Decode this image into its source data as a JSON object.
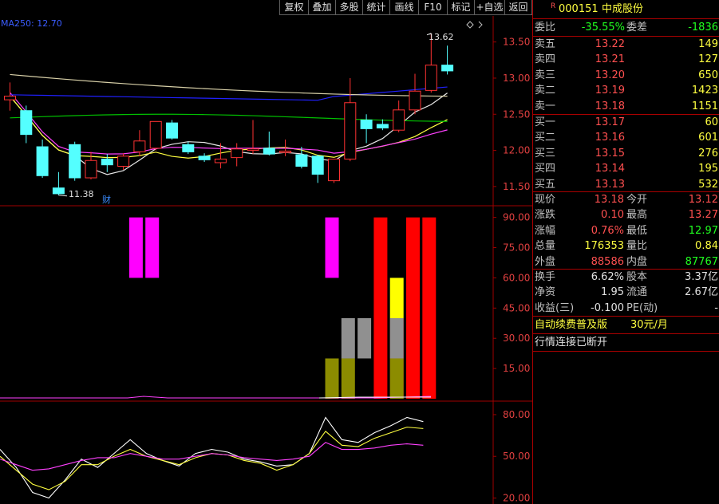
{
  "toolbar": {
    "buttons": [
      "复权",
      "叠加",
      "多股",
      "统计",
      "画线",
      "F10",
      "标记",
      "+自选",
      "返回"
    ]
  },
  "colors": {
    "up": "#ff3232",
    "down": "#54ffff",
    "ma_white": "#e8e8e8",
    "ma_yellow": "#ffff40",
    "ma_magenta": "#ff40ff",
    "ma_green": "#00c000",
    "ma250": "#2020ff",
    "grid": "#a00000"
  },
  "main_chart": {
    "ma_label": "MA250: 12.70",
    "y_ticks": [
      "13.50",
      "13.00",
      "12.50",
      "12.00",
      "11.50"
    ],
    "max_label": "13.62",
    "min_label": "11.38",
    "finance_mark": "财"
  },
  "vol_chart": {
    "y_ticks": [
      "90.00",
      "75.00",
      "60.00",
      "45.00",
      "30.00",
      "15.00"
    ]
  },
  "osc_chart": {
    "y_ticks": [
      "80.00",
      "50.00",
      "20.00"
    ]
  },
  "chart_data": [
    {
      "type": "candlestick",
      "y_range": [
        11.3,
        13.75
      ],
      "candles": [
        {
          "o": 12.7,
          "h": 12.94,
          "l": 12.55,
          "c": 12.75
        },
        {
          "o": 12.55,
          "h": 12.62,
          "l": 12.1,
          "c": 12.22
        },
        {
          "o": 12.05,
          "h": 12.15,
          "l": 11.62,
          "c": 11.65
        },
        {
          "o": 11.48,
          "h": 11.7,
          "l": 11.38,
          "c": 11.4
        },
        {
          "o": 12.08,
          "h": 12.12,
          "l": 11.58,
          "c": 11.62
        },
        {
          "o": 11.62,
          "h": 11.98,
          "l": 11.6,
          "c": 11.86
        },
        {
          "o": 11.88,
          "h": 11.95,
          "l": 11.7,
          "c": 11.8
        },
        {
          "o": 11.78,
          "h": 11.96,
          "l": 11.73,
          "c": 11.92
        },
        {
          "o": 11.98,
          "h": 12.28,
          "l": 11.92,
          "c": 12.13
        },
        {
          "o": 12.03,
          "h": 12.4,
          "l": 12.0,
          "c": 12.4
        },
        {
          "o": 12.38,
          "h": 12.42,
          "l": 12.15,
          "c": 12.17
        },
        {
          "o": 12.08,
          "h": 12.12,
          "l": 11.95,
          "c": 11.98
        },
        {
          "o": 11.92,
          "h": 11.96,
          "l": 11.84,
          "c": 11.87
        },
        {
          "o": 11.83,
          "h": 12.1,
          "l": 11.75,
          "c": 11.88
        },
        {
          "o": 11.9,
          "h": 12.1,
          "l": 11.78,
          "c": 12.02
        },
        {
          "o": 12.0,
          "h": 12.42,
          "l": 11.95,
          "c": 12.02
        },
        {
          "o": 12.03,
          "h": 12.26,
          "l": 11.93,
          "c": 11.95
        },
        {
          "o": 11.97,
          "h": 12.15,
          "l": 11.92,
          "c": 11.99
        },
        {
          "o": 11.94,
          "h": 12.05,
          "l": 11.75,
          "c": 11.78
        },
        {
          "o": 11.92,
          "h": 11.94,
          "l": 11.55,
          "c": 11.67
        },
        {
          "o": 11.58,
          "h": 11.88,
          "l": 11.55,
          "c": 11.88
        },
        {
          "o": 11.88,
          "h": 13.0,
          "l": 11.85,
          "c": 12.66
        },
        {
          "o": 12.42,
          "h": 12.5,
          "l": 12.1,
          "c": 12.3
        },
        {
          "o": 12.36,
          "h": 12.43,
          "l": 12.28,
          "c": 12.31
        },
        {
          "o": 12.28,
          "h": 12.69,
          "l": 12.25,
          "c": 12.56
        },
        {
          "o": 12.56,
          "h": 13.06,
          "l": 12.5,
          "c": 12.82
        },
        {
          "o": 12.83,
          "h": 13.62,
          "l": 12.8,
          "c": 13.18
        },
        {
          "o": 13.18,
          "h": 13.45,
          "l": 13.05,
          "c": 13.1
        }
      ]
    },
    {
      "type": "bar",
      "y_range": [
        0,
        95
      ],
      "bars": [
        {
          "i": 8,
          "color": "#ff00ff",
          "bottom": 60,
          "top": 90
        },
        {
          "i": 9,
          "color": "#ff00ff",
          "bottom": 60,
          "top": 90
        },
        {
          "i": 20,
          "color": "#ff00ff",
          "bottom": 60,
          "top": 90
        },
        {
          "i": 20,
          "color": "#8c8c00",
          "bottom": 0,
          "top": 20
        },
        {
          "i": 21,
          "color": "#8c8c00",
          "bottom": 0,
          "top": 20
        },
        {
          "i": 21,
          "color": "#909090",
          "bottom": 20,
          "top": 40
        },
        {
          "i": 22,
          "color": "#909090",
          "bottom": 20,
          "top": 40
        },
        {
          "i": 23,
          "color": "#ff0000",
          "bottom": 0,
          "top": 90
        },
        {
          "i": 24,
          "color": "#ff0000",
          "bottom": 0,
          "top": 40
        },
        {
          "i": 24,
          "color": "#909090",
          "bottom": 20,
          "top": 40
        },
        {
          "i": 24,
          "color": "#8c8c00",
          "bottom": 0,
          "top": 20
        },
        {
          "i": 24,
          "color": "#ffff00",
          "bottom": 40,
          "top": 60
        },
        {
          "i": 25,
          "color": "#ff0000",
          "bottom": 0,
          "top": 90
        },
        {
          "i": 26,
          "color": "#ff0000",
          "bottom": 0,
          "top": 90
        }
      ]
    },
    {
      "type": "line",
      "y_range": [
        18,
        88
      ],
      "series": [
        {
          "color": "#ffffff",
          "values": [
            55,
            42,
            24,
            20,
            33,
            48,
            42,
            52,
            62,
            52,
            47,
            43,
            52,
            55,
            53,
            48,
            46,
            43,
            44,
            52,
            78,
            62,
            60,
            67,
            72,
            78,
            75
          ]
        },
        {
          "color": "#ffff40",
          "values": [
            50,
            40,
            30,
            26,
            32,
            44,
            44,
            50,
            55,
            50,
            47,
            44,
            49,
            52,
            51,
            47,
            45,
            40,
            44,
            52,
            68,
            58,
            57,
            63,
            67,
            71,
            70
          ]
        },
        {
          "color": "#ff40ff",
          "values": [
            48,
            44,
            40,
            41,
            44,
            47,
            49,
            49,
            52,
            50,
            48,
            48,
            50,
            52,
            51,
            49,
            48,
            47,
            48,
            50,
            60,
            55,
            55,
            56,
            58,
            59,
            58
          ]
        }
      ]
    }
  ],
  "quote": {
    "flag": "R",
    "code": "000151",
    "name": "中成股份",
    "weibi_label": "委比",
    "weibi_value": "-35.55%",
    "weicha_label": "委差",
    "weicha_value": "-1836",
    "sells": [
      {
        "label": "卖五",
        "price": "13.22",
        "vol": "149"
      },
      {
        "label": "卖四",
        "price": "13.21",
        "vol": "127"
      },
      {
        "label": "卖三",
        "price": "13.20",
        "vol": "650"
      },
      {
        "label": "卖二",
        "price": "13.19",
        "vol": "1423"
      },
      {
        "label": "卖一",
        "price": "13.18",
        "vol": "1151"
      }
    ],
    "buys": [
      {
        "label": "买一",
        "price": "13.17",
        "vol": "60"
      },
      {
        "label": "买二",
        "price": "13.16",
        "vol": "601"
      },
      {
        "label": "买三",
        "price": "13.15",
        "vol": "276"
      },
      {
        "label": "买四",
        "price": "13.14",
        "vol": "195"
      },
      {
        "label": "买五",
        "price": "13.13",
        "vol": "532"
      }
    ],
    "stats1": [
      {
        "l1": "现价",
        "v1": "13.18",
        "c1": "red",
        "l2": "今开",
        "v2": "13.12",
        "c2": "red"
      },
      {
        "l1": "涨跌",
        "v1": "0.10",
        "c1": "red",
        "l2": "最高",
        "v2": "13.27",
        "c2": "red"
      },
      {
        "l1": "涨幅",
        "v1": "0.76%",
        "c1": "red",
        "l2": "最低",
        "v2": "12.97",
        "c2": "green"
      },
      {
        "l1": "总量",
        "v1": "176353",
        "c1": "yellow",
        "l2": "量比",
        "v2": "0.84",
        "c2": "yellow"
      },
      {
        "l1": "外盘",
        "v1": "88586",
        "c1": "red",
        "l2": "内盘",
        "v2": "87767",
        "c2": "green"
      }
    ],
    "stats2": [
      {
        "l1": "换手",
        "v1": "6.62%",
        "c1": "white",
        "l2": "股本",
        "v2": "3.37亿",
        "c2": "white"
      },
      {
        "l1": "净资",
        "v1": "1.95",
        "c1": "white",
        "l2": "流通",
        "v2": "2.67亿",
        "c2": "white"
      },
      {
        "l1": "收益(三)",
        "v1": "-0.100",
        "c1": "white",
        "l2": "PE(动)",
        "v2": "-",
        "c2": "white"
      }
    ],
    "promo_text": "自动续费普及版",
    "promo_price": "30元/月",
    "status_text": "行情连接已断开"
  }
}
